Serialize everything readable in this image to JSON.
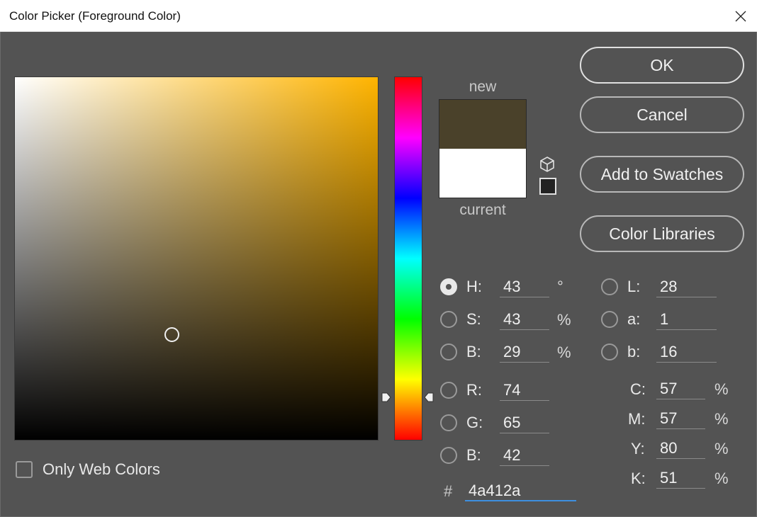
{
  "window": {
    "title": "Color Picker (Foreground Color)",
    "close_icon": "close-icon"
  },
  "colors": {
    "new_hex": "#4a412a",
    "current_hex": "#ffffff",
    "hue_base": "#ffb400"
  },
  "swatch": {
    "new_label": "new",
    "current_label": "current"
  },
  "buttons": {
    "ok": "OK",
    "cancel": "Cancel",
    "add_to_swatches": "Add to Swatches",
    "color_libraries": "Color Libraries"
  },
  "hsb": [
    {
      "label": "H:",
      "value": "43",
      "unit": "°",
      "checked": true
    },
    {
      "label": "S:",
      "value": "43",
      "unit": "%",
      "checked": false
    },
    {
      "label": "B:",
      "value": "29",
      "unit": "%",
      "checked": false
    }
  ],
  "rgb": [
    {
      "label": "R:",
      "value": "74",
      "checked": false
    },
    {
      "label": "G:",
      "value": "65",
      "checked": false
    },
    {
      "label": "B:",
      "value": "42",
      "checked": false
    }
  ],
  "lab": [
    {
      "label": "L:",
      "value": "28",
      "checked": false
    },
    {
      "label": "a:",
      "value": "1",
      "checked": false
    },
    {
      "label": "b:",
      "value": "16",
      "checked": false
    }
  ],
  "cmyk": [
    {
      "label": "C:",
      "value": "57",
      "unit": "%"
    },
    {
      "label": "M:",
      "value": "57",
      "unit": "%"
    },
    {
      "label": "Y:",
      "value": "80",
      "unit": "%"
    },
    {
      "label": "K:",
      "value": "51",
      "unit": "%"
    }
  ],
  "hex": {
    "label": "#",
    "value": "4a412a"
  },
  "only_web_colors": {
    "label": "Only Web Colors",
    "checked": false
  }
}
